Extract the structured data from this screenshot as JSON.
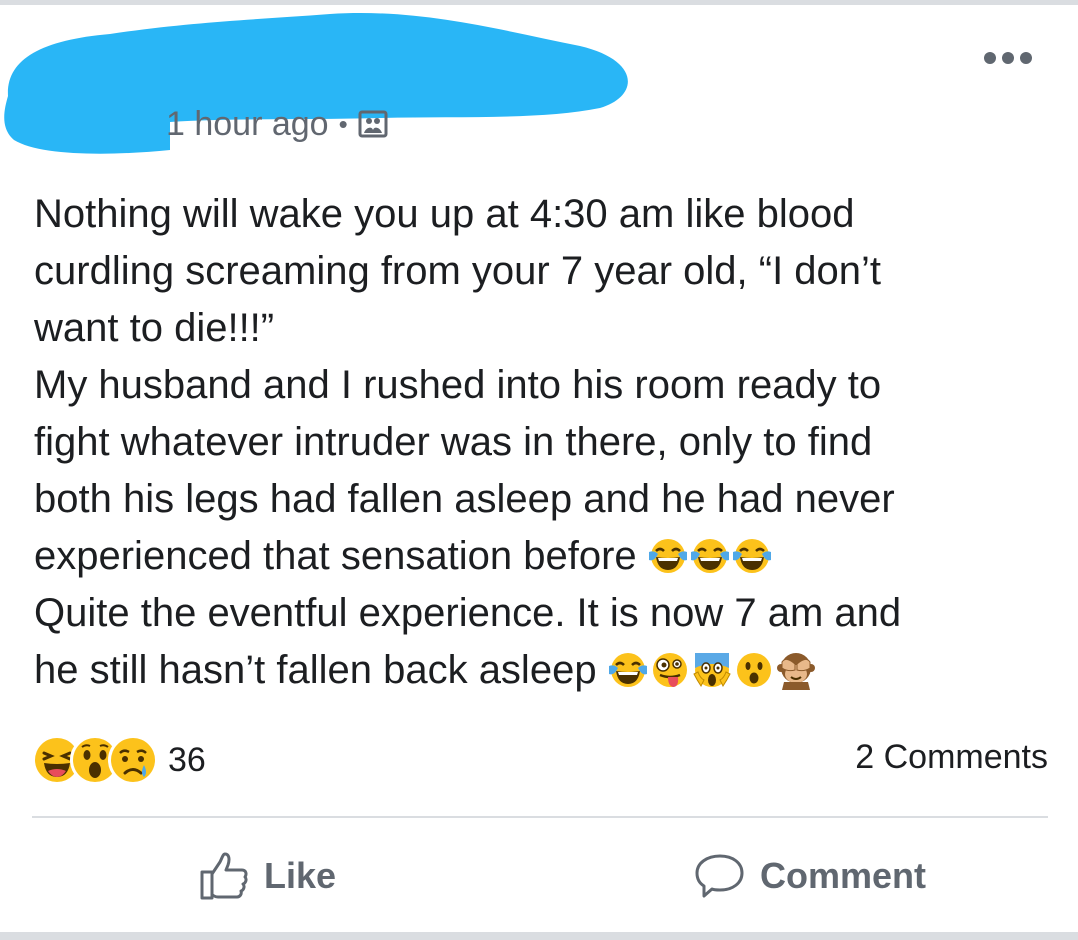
{
  "post": {
    "timestamp": "1 hour ago",
    "separator": "•",
    "privacy_icon": "image-icon",
    "more_icon": "more-dots-icon",
    "lines": [
      {
        "text": "Nothing will wake you up at 4:30 am like blood",
        "emoji": []
      },
      {
        "text": "curdling screaming from your 7 year old, “I don’t",
        "emoji": []
      },
      {
        "text": "want to die!!!”",
        "emoji": []
      },
      {
        "text": "My husband and I rushed into his room ready to",
        "emoji": []
      },
      {
        "text": "fight whatever intruder was in there, only to find",
        "emoji": []
      },
      {
        "text": "both his legs had fallen asleep and he had never",
        "emoji": []
      },
      {
        "text": "experienced that sensation before ",
        "emoji": [
          "tears-of-joy-emoji",
          "tears-of-joy-emoji",
          "tears-of-joy-emoji"
        ]
      },
      {
        "text": "Quite the eventful experience. It is now 7 am and",
        "emoji": []
      },
      {
        "text": "he still hasn’t fallen back asleep ",
        "emoji": [
          "tears-of-joy-emoji",
          "zany-face-emoji",
          "screaming-face-emoji",
          "astonished-face-emoji",
          "see-no-evil-monkey-emoji"
        ]
      }
    ]
  },
  "reactions": {
    "icons": [
      "haha-reaction-icon",
      "wow-reaction-icon",
      "sad-reaction-icon"
    ],
    "count": "36"
  },
  "comments_count": "2 Comments",
  "actions": {
    "like_label": "Like",
    "comment_label": "Comment"
  },
  "colors": {
    "redaction": "#29b6f6",
    "text": "#1c1e21",
    "secondary": "#606770",
    "emoji_yellow": "#fcc21b"
  }
}
